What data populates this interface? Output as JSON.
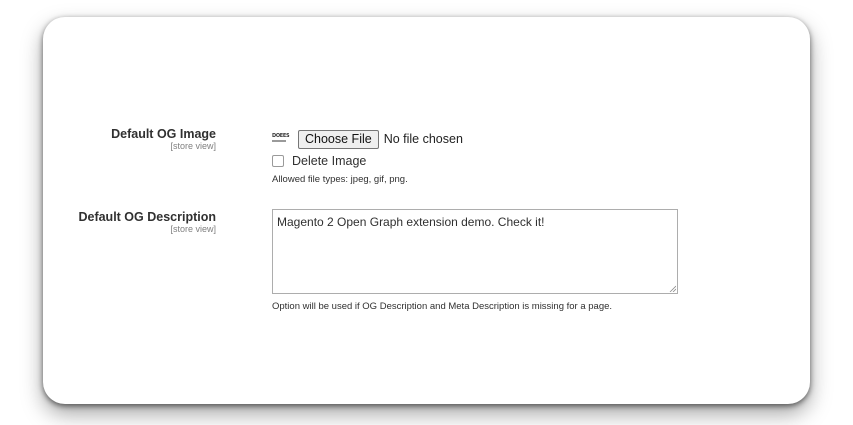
{
  "og_image": {
    "label": "Default OG Image",
    "scope": "[store view]",
    "thumbnail_text": "DOEES",
    "choose_button": "Choose File",
    "file_status": "No file chosen",
    "delete_label": "Delete Image",
    "delete_checked": false,
    "allowed_types": "Allowed file types: jpeg, gif, png."
  },
  "og_description": {
    "label": "Default OG Description",
    "scope": "[store view]",
    "value": "Magento 2 Open Graph extension demo. Check it!",
    "note": "Option will be used if OG Description and Meta Description is missing for a page."
  },
  "colors": {
    "label_text": "#303030",
    "scope_text": "#808080",
    "input_border": "#adadad",
    "button_bg": "#efefef"
  }
}
